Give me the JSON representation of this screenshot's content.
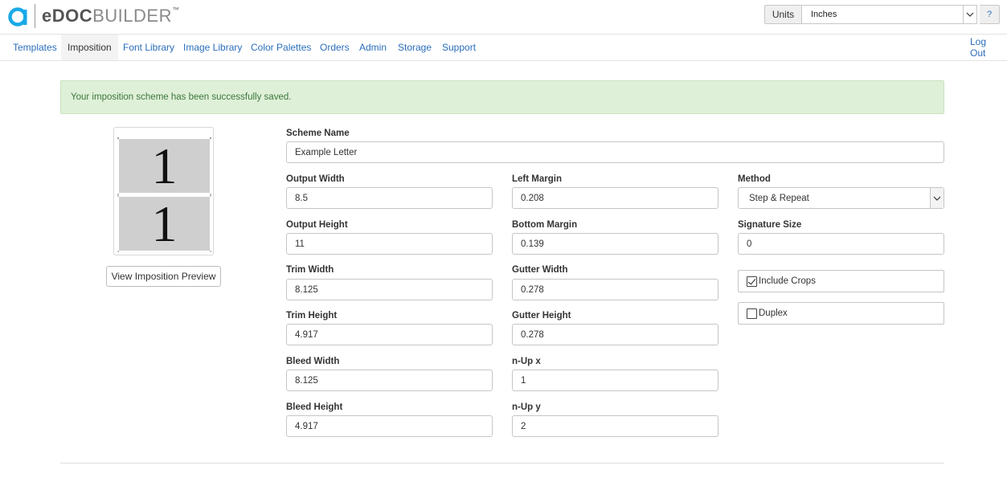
{
  "app": {
    "logo_bold": "eDOC",
    "logo_light": "BUILDER",
    "logo_tm": "™"
  },
  "header": {
    "units_label": "Units",
    "units_value": "Inches",
    "help_label": "?"
  },
  "nav": {
    "items": [
      {
        "label": "Templates"
      },
      {
        "label": "Imposition"
      },
      {
        "label": "Font Library"
      },
      {
        "label": "Image Library"
      },
      {
        "label": "Color Palettes"
      },
      {
        "label": "Orders"
      },
      {
        "label": "Admin"
      },
      {
        "label": "Storage"
      },
      {
        "label": "Support"
      }
    ],
    "active": "Imposition",
    "logout_label": "Log Out"
  },
  "alert": {
    "message": "Your imposition scheme has been successfully saved."
  },
  "preview": {
    "pages": [
      "1",
      "1"
    ],
    "view_button_label": "View Imposition Preview"
  },
  "form": {
    "scheme_name": {
      "label": "Scheme Name",
      "value": "Example Letter"
    },
    "output_width": {
      "label": "Output Width",
      "value": "8.5"
    },
    "output_height": {
      "label": "Output Height",
      "value": "11"
    },
    "trim_width": {
      "label": "Trim Width",
      "value": "8.125"
    },
    "trim_height": {
      "label": "Trim Height",
      "value": "4.917"
    },
    "bleed_width": {
      "label": "Bleed Width",
      "value": "8.125"
    },
    "bleed_height": {
      "label": "Bleed Height",
      "value": "4.917"
    },
    "left_margin": {
      "label": "Left Margin",
      "value": "0.208"
    },
    "bottom_margin": {
      "label": "Bottom Margin",
      "value": "0.139"
    },
    "gutter_width": {
      "label": "Gutter Width",
      "value": "0.278"
    },
    "gutter_height": {
      "label": "Gutter Height",
      "value": "0.278"
    },
    "nup_x": {
      "label": "n-Up x",
      "value": "1"
    },
    "nup_y": {
      "label": "n-Up y",
      "value": "2"
    },
    "method": {
      "label": "Method",
      "value": "Step & Repeat"
    },
    "signature_size": {
      "label": "Signature Size",
      "value": "0"
    },
    "include_crops": {
      "label": "Include Crops",
      "checked": true
    },
    "duplex": {
      "label": "Duplex",
      "checked": false
    }
  },
  "colors": {
    "link": "#2a6ebb",
    "alert_bg": "#dff0d8",
    "alert_text": "#3c763d",
    "logo_accent": "#1aa9e8"
  }
}
